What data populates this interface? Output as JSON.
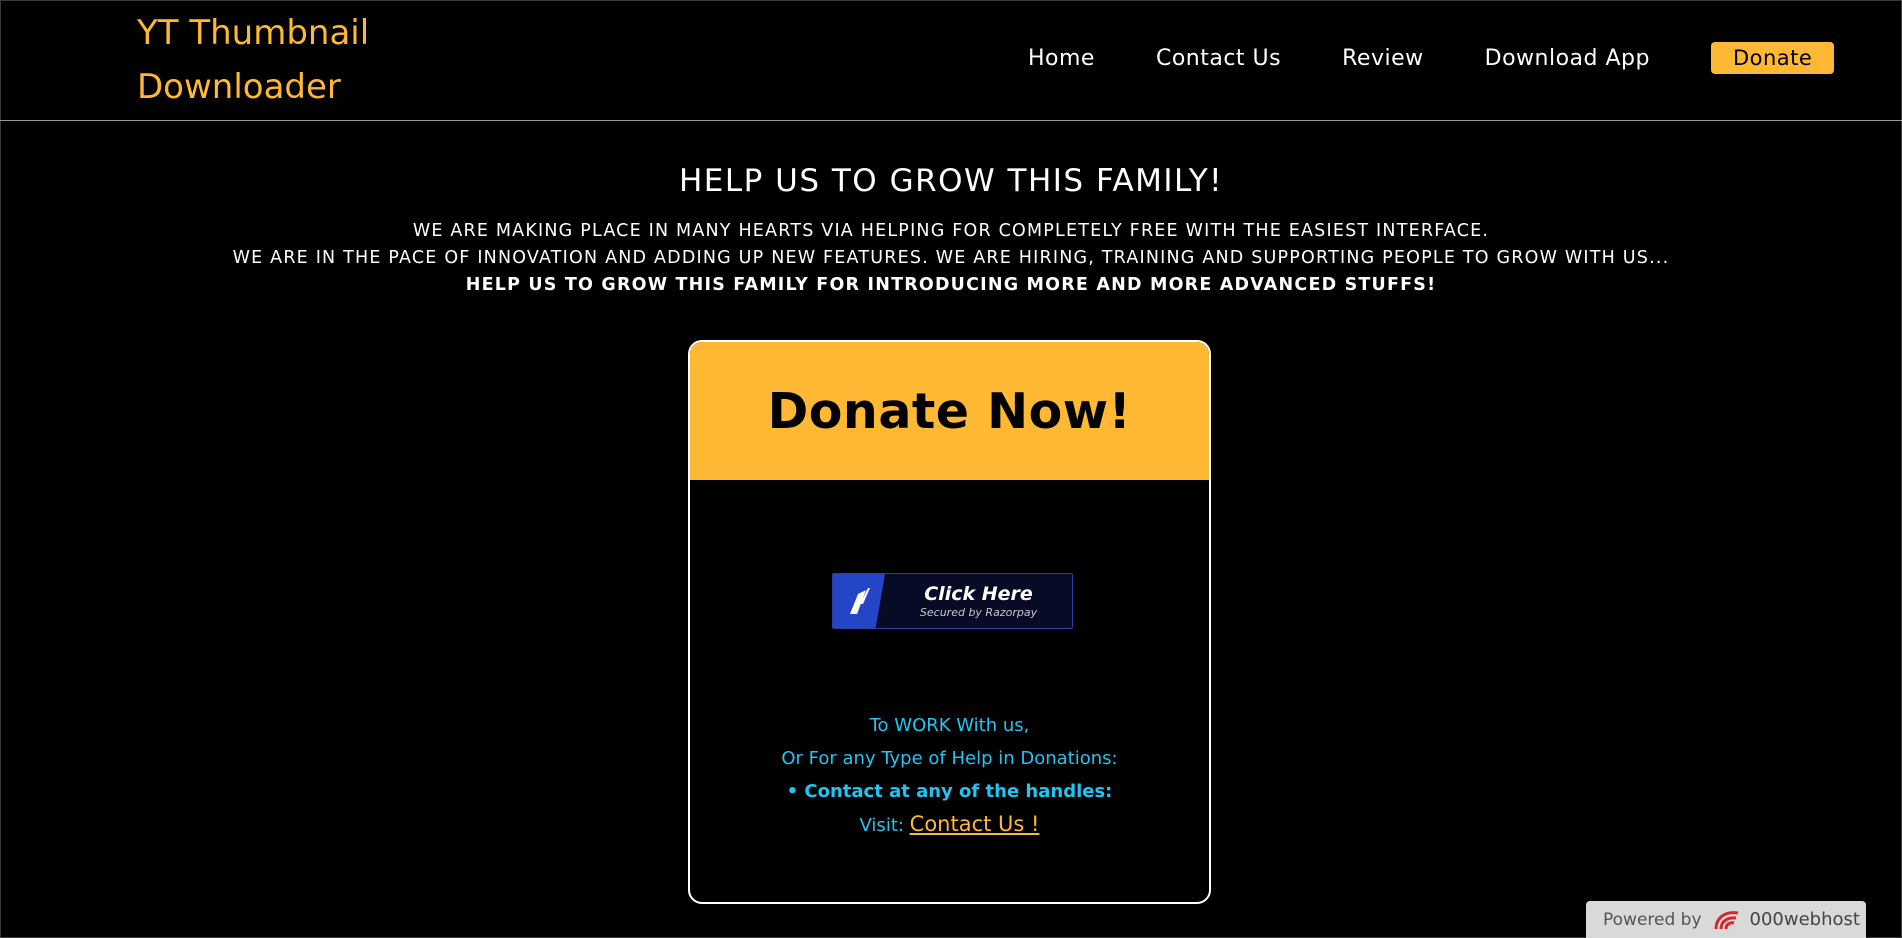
{
  "brand": {
    "line1": "YT Thumbnail",
    "line2": "Downloader"
  },
  "nav": {
    "home": "Home",
    "contact": "Contact Us",
    "review": "Review",
    "download": "Download App",
    "donate": "Donate"
  },
  "hero": {
    "title": "HELP US TO GROW THIS FAMILY!",
    "line1": "WE ARE MAKING PLACE IN MANY HEARTS VIA HELPING FOR COMPLETELY FREE WITH THE EASIEST INTERFACE.",
    "line2": "WE ARE IN THE PACE OF INNOVATION AND ADDING UP NEW FEATURES. WE ARE HIRING, TRAINING AND SUPPORTING PEOPLE TO GROW WITH US...",
    "line3": "HELP US TO GROW THIS FAMILY FOR INTRODUCING MORE AND MORE ADVANCED STUFFS!"
  },
  "card": {
    "heading": "Donate Now!",
    "razorpay": {
      "label": "Click Here",
      "sub": "Secured by Razorpay",
      "icon": "razorpay-logo-icon"
    },
    "info": {
      "line1": "To WORK With us,",
      "line2": "Or For any Type of Help in Donations:",
      "line3": "• Contact at any of the handles:",
      "visit": "Visit:",
      "link": "Contact Us !"
    }
  },
  "footer_badge": {
    "powered": "Powered by",
    "host": "000webhost",
    "icon": "000webhost-logo-icon"
  },
  "colors": {
    "accent": "#ffb833",
    "info_text": "#21c4f2",
    "background": "#000000",
    "razorpay_blue": "#2545c9"
  }
}
